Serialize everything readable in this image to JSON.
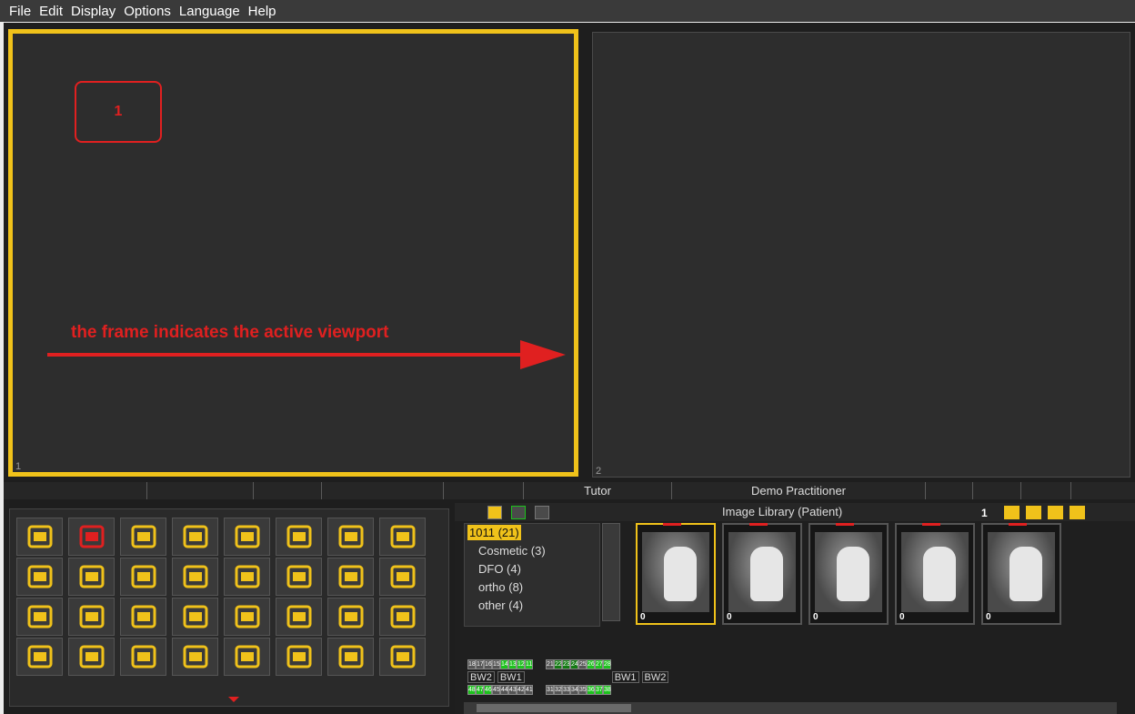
{
  "menu": [
    "File",
    "Edit",
    "Display",
    "Options",
    "Language",
    "Help"
  ],
  "viewports": {
    "vp1_number": "1",
    "vp2_number": "2"
  },
  "annotation": {
    "marker_label": "1",
    "text": "the frame indicates the active viewport"
  },
  "statusbar": {
    "cells": [
      "",
      "",
      "",
      "",
      "",
      "Tutor",
      "Demo Practitioner",
      "",
      "",
      "",
      ""
    ]
  },
  "library": {
    "title": "Image Library (Patient)",
    "count": "1",
    "tree": [
      {
        "label": "1011 (21)",
        "root": true
      },
      {
        "label": "Cosmetic (3)"
      },
      {
        "label": "DFO (4)"
      },
      {
        "label": "ortho (8)"
      },
      {
        "label": "other (4)"
      }
    ],
    "thumbnails": [
      {
        "label": "0",
        "active": true
      },
      {
        "label": "0"
      },
      {
        "label": "0"
      },
      {
        "label": "0"
      },
      {
        "label": "0"
      }
    ],
    "tooth_chart": {
      "upper_right": [
        "18",
        "17",
        "16",
        "15",
        "14",
        "13",
        "12",
        "11"
      ],
      "upper_left": [
        "21",
        "22",
        "23",
        "24",
        "25",
        "26",
        "27",
        "28"
      ],
      "bitewing_left": [
        "BW2",
        "BW1"
      ],
      "bitewing_right": [
        "BW1",
        "BW2"
      ],
      "lower_right": [
        "48",
        "47",
        "46",
        "45",
        "44",
        "43",
        "42",
        "41"
      ],
      "lower_left": [
        "31",
        "32",
        "33",
        "34",
        "35",
        "36",
        "37",
        "38"
      ]
    }
  },
  "tools": [
    "image-library-icon",
    "teeth-icon",
    "edit-icon",
    "zoom-region-icon",
    "viewport-2-icon",
    "magnify-icon",
    "save-icon",
    "trash-icon",
    "adjust-icon",
    "rotate-90-icon",
    "mirror-icon",
    "split-icon",
    "image-icon",
    "print-icon",
    "radiation-icon",
    "radiation-settings-icon",
    "pen-icon",
    "camera-icon",
    "check-icon",
    "image-transfer-icon",
    "twain-icon",
    "sort-icon",
    "document-icon",
    "monitor-icon",
    "monitor-2-icon",
    "cam-pen-icon",
    "bulb-icon",
    "triangle-icon",
    "overlap-icon",
    "lips-icon",
    "skull-icon",
    "settings-filter-icon"
  ]
}
